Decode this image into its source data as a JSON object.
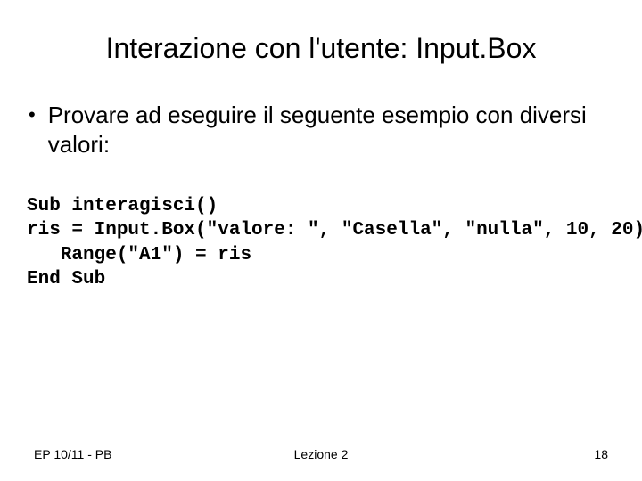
{
  "title": "Interazione con l'utente: Input.Box",
  "bullet": "Provare ad eseguire il seguente esempio con diversi valori:",
  "code": "Sub interagisci()\nris = Input.Box(\"valore: \", \"Casella\", \"nulla\", 10, 20)\n   Range(\"A1\") = ris\nEnd Sub",
  "footer": {
    "left": "EP 10/11 - PB",
    "center": "Lezione 2",
    "right": "18"
  }
}
